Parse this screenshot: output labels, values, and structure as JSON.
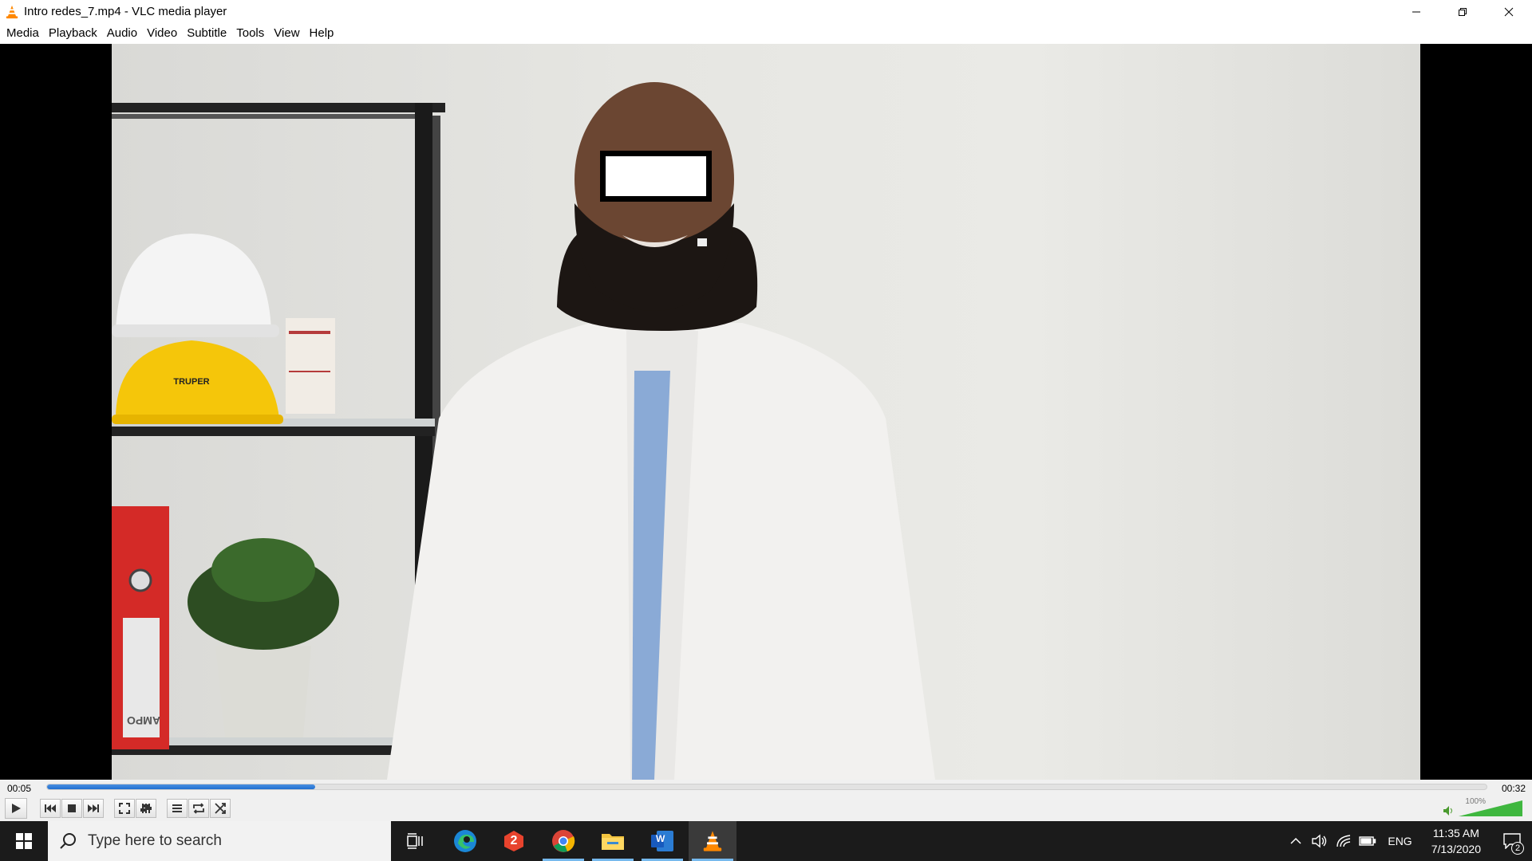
{
  "window": {
    "title": "Intro redes_7.mp4 - VLC media player",
    "accent": "#ff8800"
  },
  "menu": [
    "Media",
    "Playback",
    "Audio",
    "Video",
    "Subtitle",
    "Tools",
    "View",
    "Help"
  ],
  "video": {
    "helmet_text": "TRUPER",
    "binder_text": "AMPO"
  },
  "player": {
    "elapsed": "00:05",
    "total": "00:32",
    "progress_fraction": 0.186,
    "volume_label": "100%",
    "volume_fraction": 1.0
  },
  "taskbar": {
    "search_placeholder": "Type here to search",
    "apps": [
      "task-view",
      "edge",
      "counter-app",
      "chrome",
      "file-explorer",
      "word",
      "vlc"
    ],
    "counter_badge": "2",
    "word_letter": "W",
    "language": "ENG",
    "time": "11:35 AM",
    "date": "7/13/2020",
    "notification_count": "2"
  }
}
